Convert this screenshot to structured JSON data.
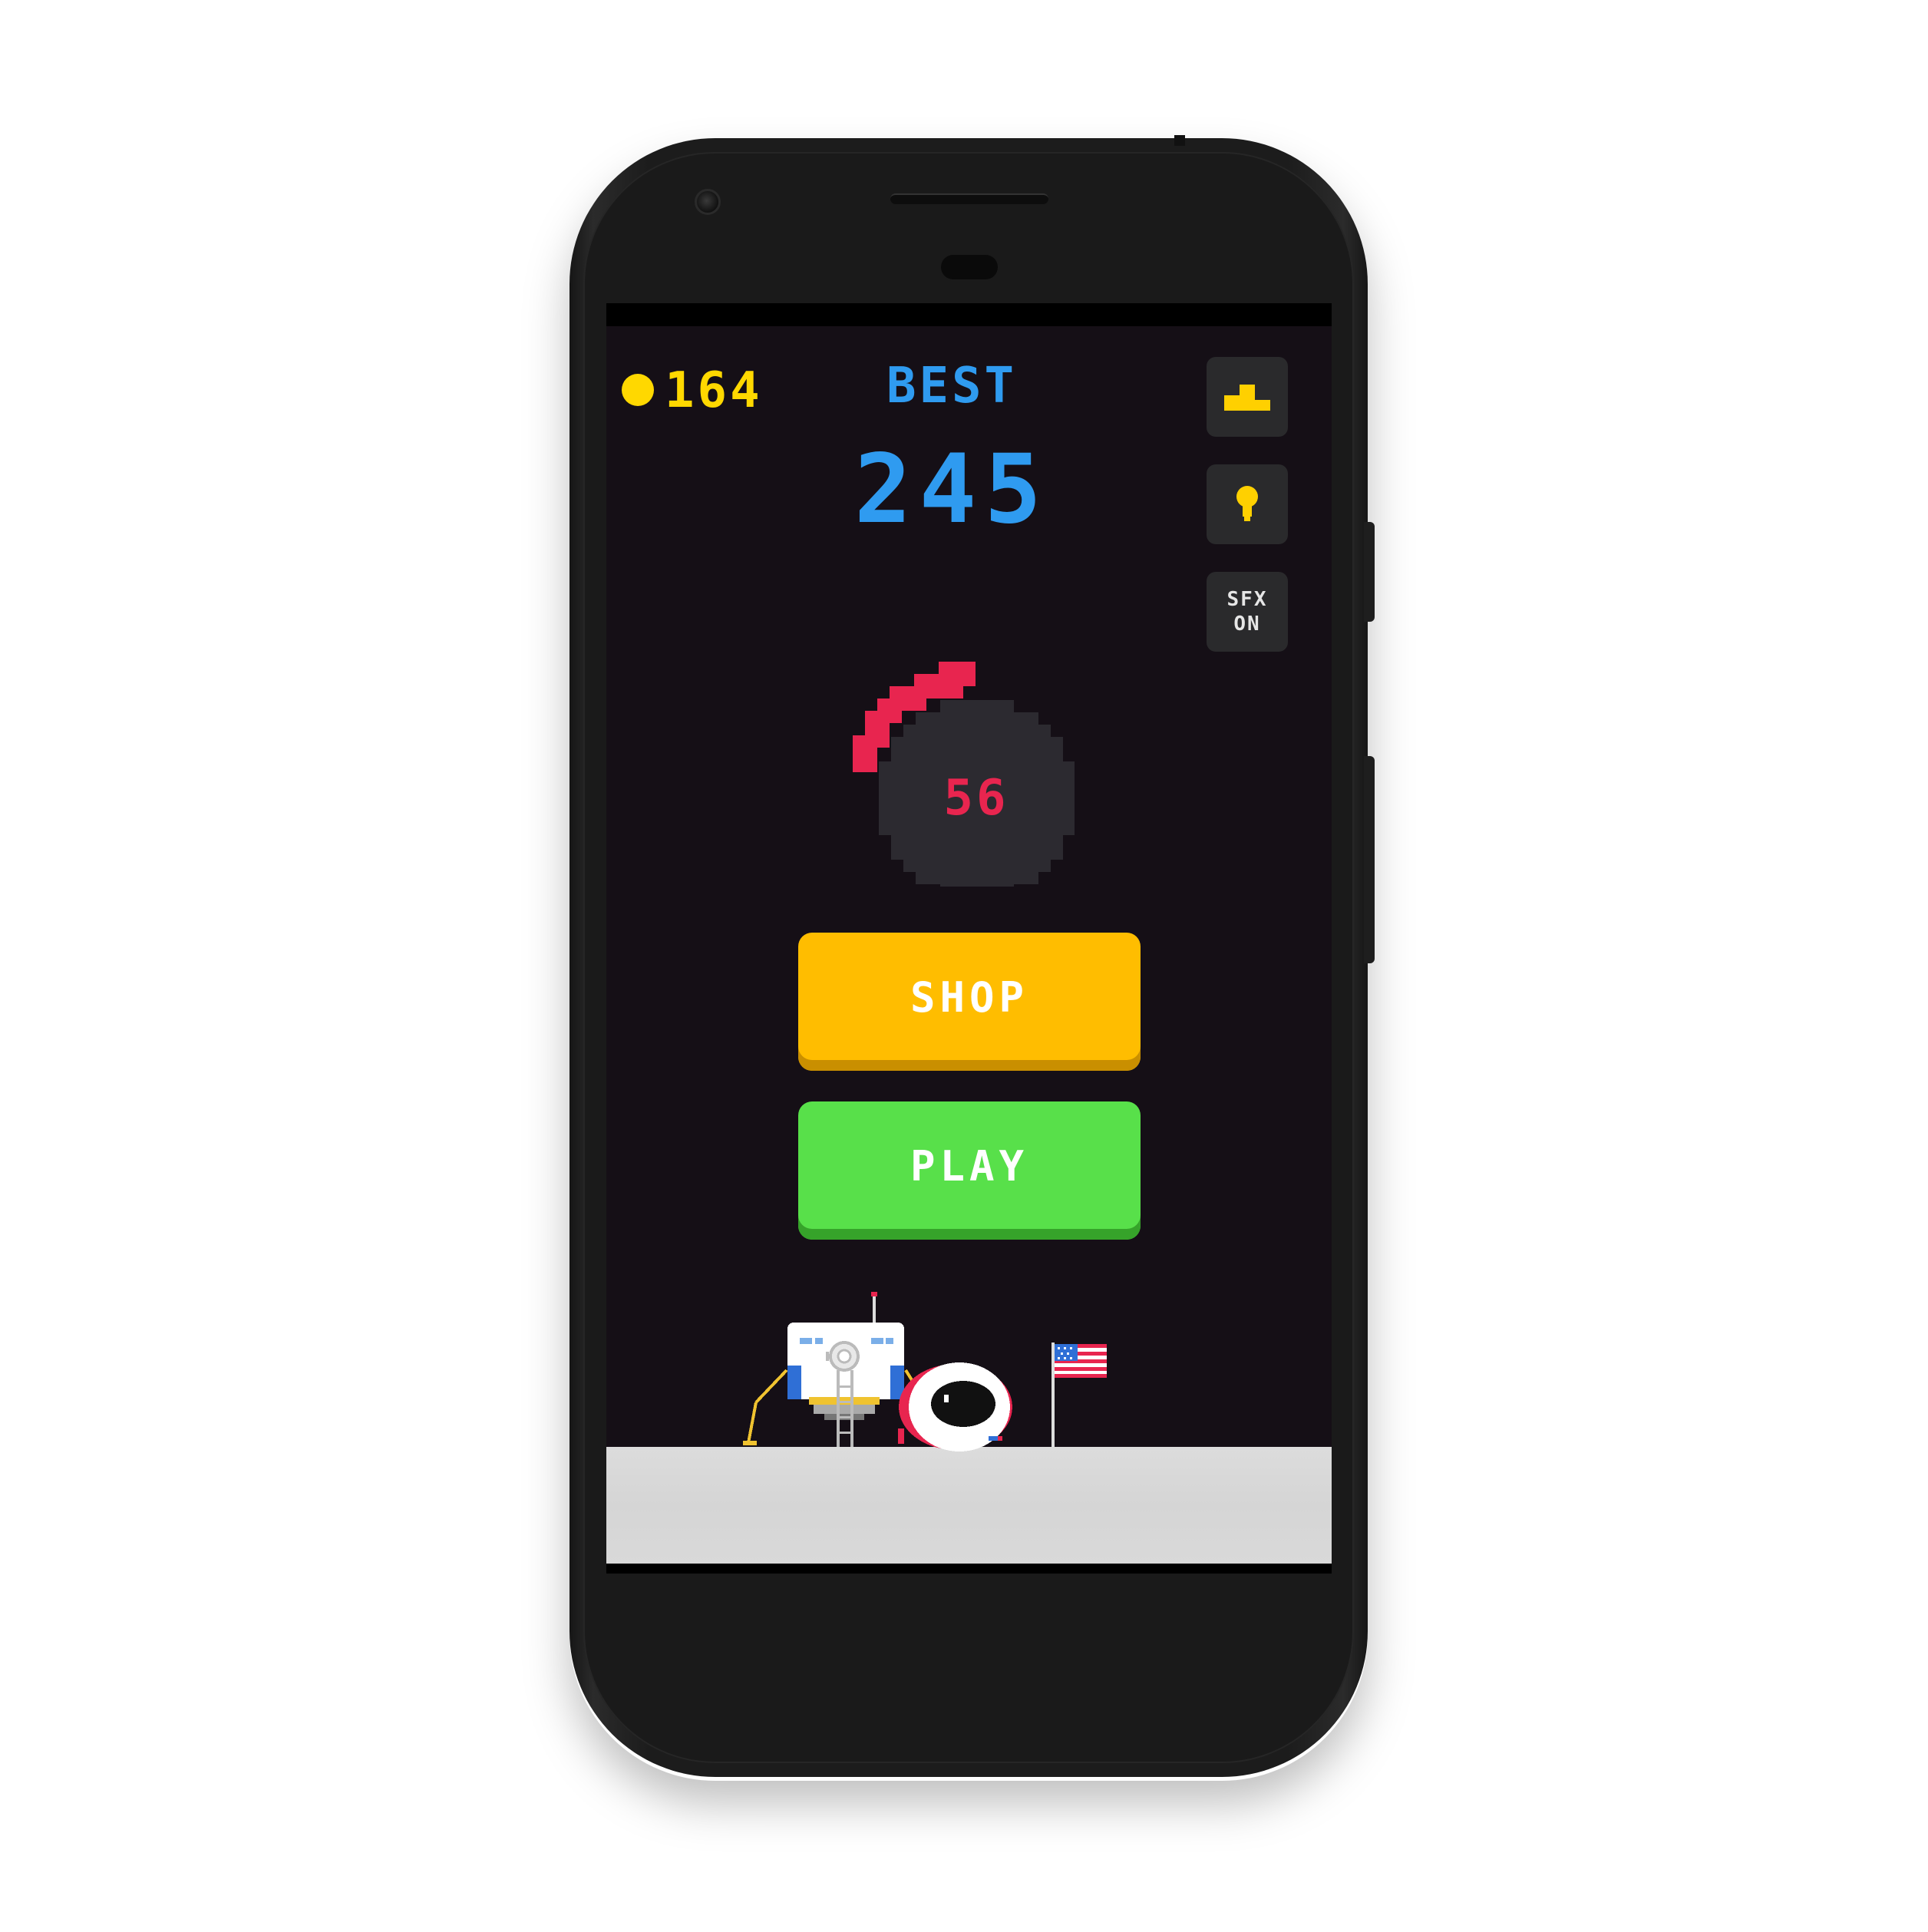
{
  "hud": {
    "coins": "164",
    "best_label": "BEST",
    "best_score": "245"
  },
  "side_buttons": {
    "leaderboard_icon": "leaderboard-icon",
    "hint_icon": "lightbulb-icon",
    "sfx_line1": "SFX",
    "sfx_line2": "ON"
  },
  "dial": {
    "value": "56"
  },
  "menu": {
    "shop_label": "SHOP",
    "play_label": "PLAY"
  },
  "colors": {
    "background": "#150f16",
    "coin": "#ffd800",
    "best": "#2f9bf0",
    "dial_arc": "#e8254f",
    "dial_body": "#2c2a30",
    "shop": "#ffbd00",
    "shop_shadow": "#c98f00",
    "play": "#58e04a",
    "play_shadow": "#36a32a",
    "icon_yellow": "#ffd000",
    "ground": "#d8d8d8"
  },
  "scene": {
    "items": [
      "lunar-lander",
      "astronaut-helmet",
      "us-flag"
    ]
  }
}
